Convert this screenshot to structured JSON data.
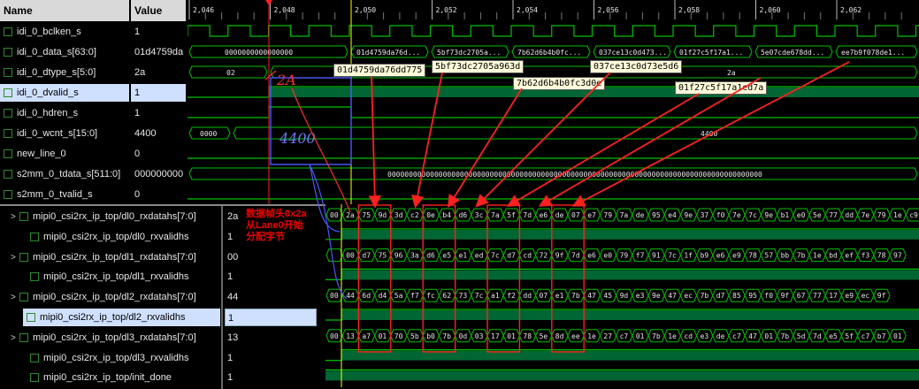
{
  "top": {
    "name_header": "Name",
    "value_header": "Value",
    "ticks": [
      "2,046",
      "2,048",
      "2,050",
      "2,052",
      "2,054",
      "2,056",
      "2,058",
      "2,060",
      "2,062"
    ],
    "signals": [
      {
        "name": "idi_0_bclken_s",
        "value": "1"
      },
      {
        "name": "idi_0_data_s[63:0]",
        "value": "01d4759da"
      },
      {
        "name": "idi_0_dtype_s[5:0]",
        "value": "2a"
      },
      {
        "name": "idi_0_dvalid_s",
        "value": "1"
      },
      {
        "name": "idi_0_hdren_s",
        "value": "1"
      },
      {
        "name": "idi_0_wcnt_s[15:0]",
        "value": "4400"
      },
      {
        "name": "new_line_0",
        "value": "0"
      },
      {
        "name": "s2mm_0_tdata_s[511:0]",
        "value": "000000000"
      },
      {
        "name": "s2mm_0_tvalid_s",
        "value": "0"
      }
    ],
    "data_words": [
      "0000000000000000",
      "01d4759da76d...",
      "5bf73dc2705a...",
      "7b62d6b4b0fc...",
      "037ce13c0d473...",
      "01f27c5f17a1...",
      "5e07cde678dd...",
      "ee7b9f078de1..."
    ],
    "dtype_values": [
      "02",
      "2a"
    ],
    "wcnt_values": [
      "0000",
      "4400"
    ],
    "tdata_value": "0000000000000000000000000000000000000000000000000000000000000000000000000000000000000000",
    "callouts": [
      "01d4759da76dd775",
      "5bf73dc2705a963d",
      "7b62d6b4b0fc3d0e",
      "037ce13c0d73e5d6",
      "01f27c5f17a1ed7a"
    ],
    "handwriting": [
      "2A",
      "4400"
    ]
  },
  "bottom": {
    "signals": [
      {
        "name": "mipi0_csi2rx_ip_top/dl0_rxdatahs[7:0]",
        "value": "2a",
        "expand": true
      },
      {
        "name": "mipi0_csi2rx_ip_top/dl0_rxvalidhs",
        "value": "1",
        "expand": false
      },
      {
        "name": "mipi0_csi2rx_ip_top/dl1_rxdatahs[7:0]",
        "value": "00",
        "expand": true
      },
      {
        "name": "mipi0_csi2rx_ip_top/dl1_rxvalidhs",
        "value": "1",
        "expand": false
      },
      {
        "name": "mipi0_csi2rx_ip_top/dl2_rxdatahs[7:0]",
        "value": "44",
        "expand": true
      },
      {
        "name": "mipi0_csi2rx_ip_top/dl2_rxvalidhs",
        "value": "1",
        "expand": false
      },
      {
        "name": "mipi0_csi2rx_ip_top/dl3_rxdatahs[7:0]",
        "value": "13",
        "expand": true
      },
      {
        "name": "mipi0_csi2rx_ip_top/dl3_rxvalidhs",
        "value": "1",
        "expand": false
      },
      {
        "name": "mipi0_csi2rx_ip_top/init_done",
        "value": "1",
        "expand": false
      }
    ],
    "lanes": [
      [
        "00",
        "2a",
        "75",
        "9d",
        "3d",
        "c2",
        "0e",
        "b4",
        "d6",
        "3c",
        "7a",
        "5f",
        "7d",
        "e6",
        "de",
        "07",
        "e7",
        "79",
        "7a",
        "de",
        "95",
        "e4",
        "9e",
        "37",
        "f0",
        "7e",
        "7c",
        "9e",
        "b1",
        "e0",
        "5e",
        "77",
        "dd",
        "7e",
        "79",
        "1e",
        "c9"
      ],
      [
        "",
        "00",
        "d7",
        "75",
        "96",
        "3a",
        "d6",
        "e5",
        "e1",
        "ed",
        "7c",
        "d7",
        "cd",
        "72",
        "9f",
        "7d",
        "e6",
        "e0",
        "79",
        "f7",
        "91",
        "7c",
        "1f",
        "b9",
        "e6",
        "e9",
        "78",
        "57",
        "bb",
        "7b",
        "1e",
        "bd",
        "ef",
        "f3",
        "78",
        "97"
      ],
      [
        "00",
        "44",
        "6d",
        "d4",
        "5a",
        "f7",
        "fc",
        "62",
        "73",
        "7c",
        "a1",
        "f2",
        "dd",
        "07",
        "e1",
        "7b",
        "47",
        "45",
        "9d",
        "e3",
        "9e",
        "47",
        "ec",
        "7b",
        "d7",
        "85",
        "95",
        "f0",
        "9f",
        "67",
        "77",
        "17",
        "e9",
        "ec",
        "9f"
      ],
      [
        "00",
        "13",
        "a7",
        "01",
        "70",
        "5b",
        "b0",
        "7b",
        "0d",
        "03",
        "17",
        "01",
        "78",
        "5e",
        "8d",
        "ee",
        "1e",
        "27",
        "c7",
        "01",
        "7b",
        "1e",
        "cd",
        "e3",
        "de",
        "c7",
        "47",
        "01",
        "7b",
        "5d",
        "7d",
        "e5",
        "5f",
        "c7",
        "b7",
        "01"
      ]
    ],
    "annotation": [
      "数据帧头0x2a",
      "从Lane0开始",
      "分配字节"
    ]
  },
  "colors": {
    "wave": "#00c000",
    "marker_red": "#ff2020",
    "cursor_yellow": "#ffff00",
    "annotation_red": "#e00000",
    "box_blue": "#4a5aff"
  }
}
